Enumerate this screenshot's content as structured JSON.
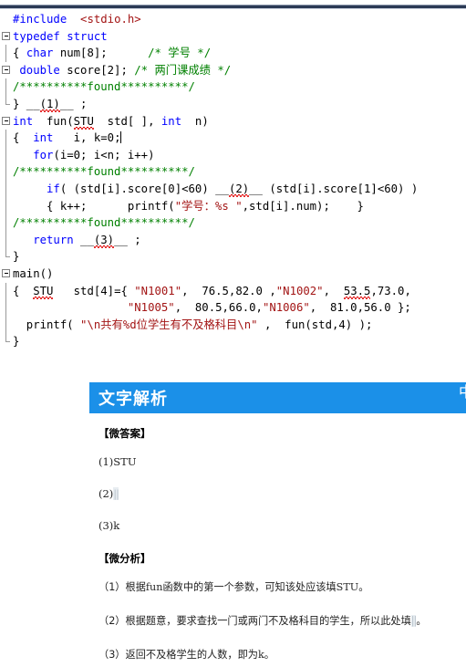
{
  "editor": {
    "lines": [
      {
        "id": "l1",
        "gutter": "none",
        "indent": 1,
        "tokens": [
          {
            "t": "#include ",
            "c": "pre"
          },
          {
            "t": " ",
            "c": "plain"
          },
          {
            "t": "<stdio.h>",
            "c": "str"
          }
        ]
      },
      {
        "id": "l2",
        "gutter": "fold-open",
        "indent": 0,
        "tokens": [
          {
            "t": "typedef",
            "c": "kw"
          },
          {
            "t": " ",
            "c": "plain"
          },
          {
            "t": "struct",
            "c": "kw"
          }
        ]
      },
      {
        "id": "l3",
        "gutter": "line",
        "indent": 1,
        "tokens": [
          {
            "t": "{ ",
            "c": "plain"
          },
          {
            "t": "char",
            "c": "kw"
          },
          {
            "t": " num[8];      ",
            "c": "plain"
          },
          {
            "t": "/* 学号 */",
            "c": "cmt"
          }
        ]
      },
      {
        "id": "l4",
        "gutter": "fold-open",
        "indent": 1,
        "tokens": [
          {
            "t": " ",
            "c": "plain"
          },
          {
            "t": "double",
            "c": "kw"
          },
          {
            "t": " score[2]; ",
            "c": "plain"
          },
          {
            "t": "/* 两门课成绩 */",
            "c": "cmt"
          }
        ]
      },
      {
        "id": "l5",
        "gutter": "line",
        "indent": 0,
        "tokens": [
          {
            "t": "/**********found**********/",
            "c": "cmt"
          }
        ]
      },
      {
        "id": "l6",
        "gutter": "line-end",
        "indent": 0,
        "tokens": [
          {
            "t": "} __",
            "c": "plain"
          },
          {
            "t": "(1)",
            "c": "plain",
            "wavy": true
          },
          {
            "t": "__ ;",
            "c": "plain"
          }
        ]
      },
      {
        "id": "l7",
        "gutter": "fold-open",
        "indent": 0,
        "tokens": [
          {
            "t": "int",
            "c": "kw"
          },
          {
            "t": "  fun(",
            "c": "plain"
          },
          {
            "t": "STU",
            "c": "plain",
            "wavy": true
          },
          {
            "t": "  std[ ], ",
            "c": "plain"
          },
          {
            "t": "int",
            "c": "kw"
          },
          {
            "t": "  n)",
            "c": "plain"
          }
        ]
      },
      {
        "id": "l8",
        "gutter": "line",
        "indent": 1,
        "tokens": [
          {
            "t": "{  ",
            "c": "plain"
          },
          {
            "t": "int",
            "c": "kw"
          },
          {
            "t": "   i, k=0;",
            "c": "plain"
          }
        ],
        "caret": true
      },
      {
        "id": "l9",
        "gutter": "line",
        "indent": 1,
        "tokens": [
          {
            "t": "   ",
            "c": "plain"
          },
          {
            "t": "for",
            "c": "kw"
          },
          {
            "t": "(i=0; i<n; i++)",
            "c": "plain"
          }
        ]
      },
      {
        "id": "l10",
        "gutter": "line",
        "indent": 0,
        "tokens": [
          {
            "t": "/**********found**********/",
            "c": "cmt"
          }
        ]
      },
      {
        "id": "l11",
        "gutter": "line",
        "indent": 1,
        "tokens": [
          {
            "t": "     ",
            "c": "plain"
          },
          {
            "t": "if",
            "c": "kw"
          },
          {
            "t": "( (std[i].score[0]<60) __",
            "c": "plain"
          },
          {
            "t": "(2)",
            "c": "plain",
            "wavy": true
          },
          {
            "t": "__ (std[i].score[1]<60) )",
            "c": "plain"
          }
        ]
      },
      {
        "id": "l12",
        "gutter": "line",
        "indent": 1,
        "tokens": [
          {
            "t": "     { k++;      printf(",
            "c": "plain"
          },
          {
            "t": "\"学号：%s \"",
            "c": "str"
          },
          {
            "t": ",std[i].num);    }",
            "c": "plain"
          }
        ]
      },
      {
        "id": "l13",
        "gutter": "line",
        "indent": 0,
        "tokens": [
          {
            "t": "/**********found**********/",
            "c": "cmt"
          }
        ]
      },
      {
        "id": "l14",
        "gutter": "line",
        "indent": 1,
        "tokens": [
          {
            "t": "   ",
            "c": "plain"
          },
          {
            "t": "return",
            "c": "kw"
          },
          {
            "t": " __",
            "c": "plain"
          },
          {
            "t": "(3)",
            "c": "plain",
            "wavy": true
          },
          {
            "t": "__ ;",
            "c": "plain"
          }
        ]
      },
      {
        "id": "l15",
        "gutter": "line-end",
        "indent": 1,
        "tokens": [
          {
            "t": "}",
            "c": "plain"
          }
        ]
      },
      {
        "id": "l16",
        "gutter": "fold-open",
        "indent": 0,
        "tokens": [
          {
            "t": "main()",
            "c": "plain"
          }
        ]
      },
      {
        "id": "l17",
        "gutter": "line",
        "indent": 1,
        "tokens": [
          {
            "t": "{  ",
            "c": "plain"
          },
          {
            "t": "STU",
            "c": "plain",
            "wavy": true
          },
          {
            "t": "   std[4]={ ",
            "c": "plain"
          },
          {
            "t": "\"N1001\"",
            "c": "str"
          },
          {
            "t": ",  76.5,82.0 ,",
            "c": "plain"
          },
          {
            "t": "\"N1002\"",
            "c": "str"
          },
          {
            "t": ",  ",
            "c": "plain"
          },
          {
            "t": "53.5",
            "c": "plain",
            "wavy": true
          },
          {
            "t": ",73.0,",
            "c": "plain"
          }
        ]
      },
      {
        "id": "l18",
        "gutter": "line",
        "indent": 1,
        "tokens": [
          {
            "t": "                 ",
            "c": "plain"
          },
          {
            "t": "\"N1005\"",
            "c": "str"
          },
          {
            "t": ",  80.5,66.0,",
            "c": "plain"
          },
          {
            "t": "\"N1006\"",
            "c": "str"
          },
          {
            "t": ",  81.0,56.0 };",
            "c": "plain"
          }
        ]
      },
      {
        "id": "l19",
        "gutter": "line",
        "indent": 1,
        "tokens": [
          {
            "t": "  printf( ",
            "c": "plain"
          },
          {
            "t": "\"\\n共有%d位学生有不及格科目\\n\"",
            "c": "str"
          },
          {
            "t": " ,  fun(std,4) );",
            "c": "plain"
          }
        ]
      },
      {
        "id": "l20",
        "gutter": "line-end",
        "indent": 1,
        "tokens": [
          {
            "t": "}",
            "c": "plain"
          }
        ]
      }
    ]
  },
  "analysis": {
    "header": {
      "title": "文字解析",
      "right_glyph": "中"
    },
    "answers": {
      "heading": "【微答案】",
      "items": [
        {
          "label": "(1)",
          "value": "STU",
          "blank": false
        },
        {
          "label": "(2)",
          "value": "||",
          "blank": true
        },
        {
          "label": "(3)",
          "value": "k",
          "blank": false
        }
      ]
    },
    "explanation": {
      "heading": "【微分析】",
      "items": [
        {
          "label": "（1）",
          "text_before": "根据",
          "code1": "fun",
          "text_mid": "函数中的第一个参数，可知该处应该填",
          "code2": "STU",
          "text_after": "。",
          "blank": false
        },
        {
          "label": "（2）",
          "text_before": "根据题意，要求查找一门或两门不及格科目的学生，所以此处填",
          "code1": "",
          "text_mid": "",
          "code2": "||",
          "text_after": "。",
          "blank": true
        },
        {
          "label": "（3）",
          "text_before": "返回不及格学生的人数，即为",
          "code1": "",
          "text_mid": "",
          "code2": "k",
          "text_after": "。",
          "blank": false
        }
      ]
    }
  },
  "colors": {
    "header_blue": "#1b90e8",
    "keyword": "#0000ff",
    "string": "#a31515",
    "comment": "#008000",
    "top_rule": "#2b3a55"
  }
}
